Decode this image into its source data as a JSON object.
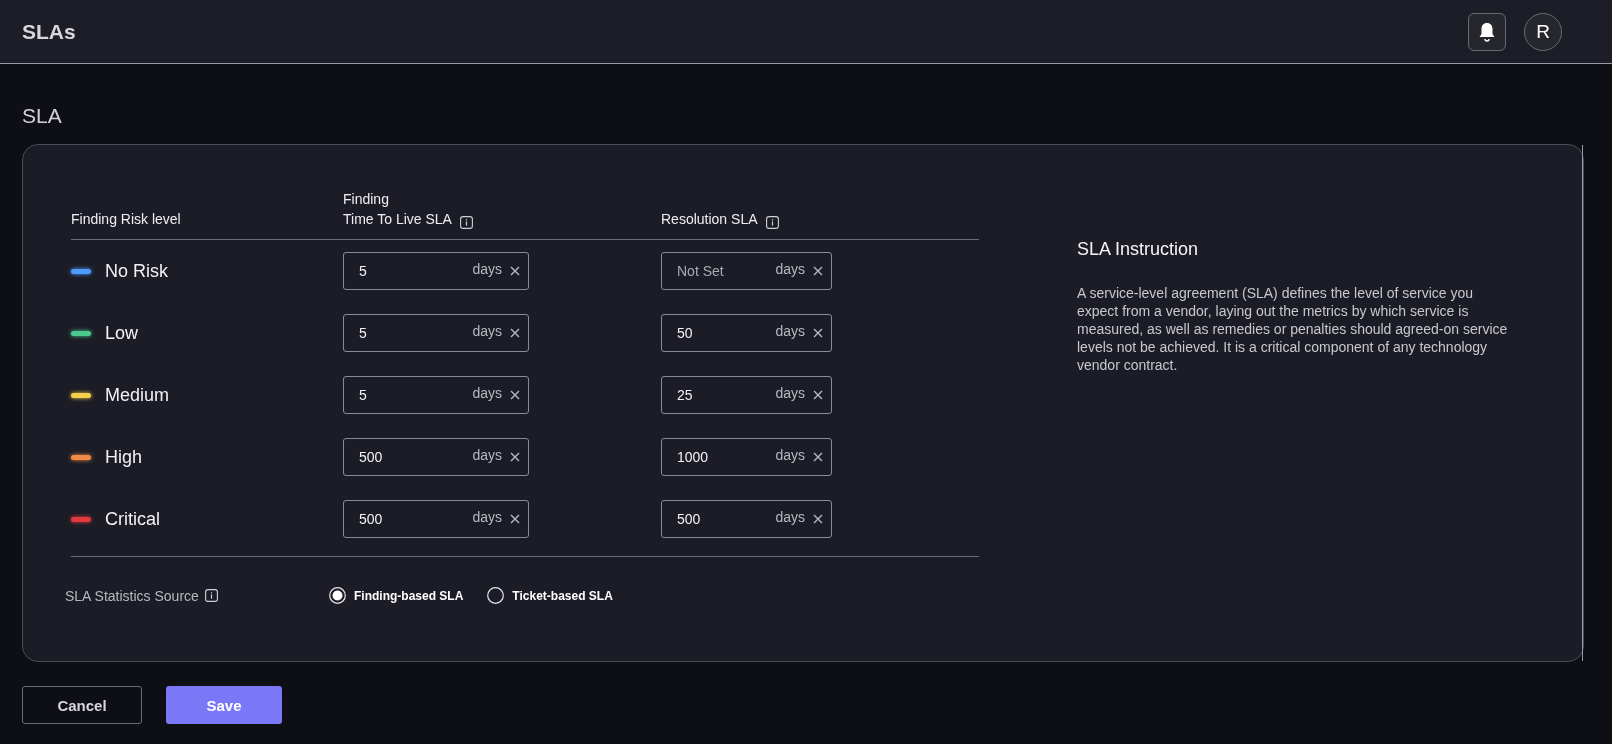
{
  "header": {
    "title": "SLAs",
    "avatar": "R"
  },
  "section_title": "SLA",
  "table": {
    "columns": [
      "Finding Risk level",
      "Finding\nTime To Live SLA",
      "Resolution SLA"
    ],
    "rows": [
      {
        "risk": "No Risk",
        "color": "#4f9cff",
        "ttl": {
          "value": "5",
          "unit": "days"
        },
        "resolution": {
          "placeholder": "Not Set",
          "unit": "days"
        }
      },
      {
        "risk": "Low",
        "color": "#4cc98f",
        "ttl": {
          "value": "5",
          "unit": "days"
        },
        "resolution": {
          "value": "50",
          "unit": "days"
        }
      },
      {
        "risk": "Medium",
        "color": "#f5d04a",
        "ttl": {
          "value": "5",
          "unit": "days"
        },
        "resolution": {
          "value": "25",
          "unit": "days"
        }
      },
      {
        "risk": "High",
        "color": "#f08a44",
        "ttl": {
          "value": "500",
          "unit": "days"
        },
        "resolution": {
          "value": "1000",
          "unit": "days"
        }
      },
      {
        "risk": "Critical",
        "color": "#e0393e",
        "ttl": {
          "value": "500",
          "unit": "days"
        },
        "resolution": {
          "value": "500",
          "unit": "days"
        }
      }
    ]
  },
  "statistics_source": {
    "label": "SLA Statistics Source",
    "options": [
      {
        "label": "Finding-based SLA",
        "selected": true
      },
      {
        "label": "Ticket-based SLA",
        "selected": false
      }
    ]
  },
  "instruction": {
    "title": "SLA Instruction",
    "text": "A service-level agreement (SLA) defines the level of service you expect from a vendor, laying out the metrics by which service is measured, as well as remedies or penalties should agreed-on service levels not be achieved. It is a critical component of any technology vendor contract."
  },
  "buttons": {
    "cancel": "Cancel",
    "save": "Save"
  }
}
